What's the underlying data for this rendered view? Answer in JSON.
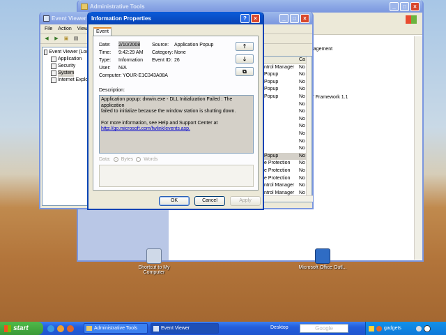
{
  "admin_window": {
    "title": "Administrative Tools",
    "right_items": [
      "anagement",
      "ET Framework 1.1"
    ]
  },
  "event_viewer": {
    "title": "Event Viewer",
    "menu": [
      "File",
      "Action",
      "View"
    ],
    "tree": [
      "Event Viewer (Loc",
      "Application",
      "Security",
      "System",
      "Internet Explo"
    ],
    "col_source_header": "",
    "col_category_header": "Ca",
    "rows": [
      {
        "source": "ntrol Manager",
        "cat": "No"
      },
      {
        "source": "Popup",
        "cat": "No"
      },
      {
        "source": "Popup",
        "cat": "No"
      },
      {
        "source": "Popup",
        "cat": "No"
      },
      {
        "source": "Popup",
        "cat": "No"
      },
      {
        "source": "",
        "cat": "No"
      },
      {
        "source": "",
        "cat": "No"
      },
      {
        "source": "",
        "cat": "No"
      },
      {
        "source": "",
        "cat": "No"
      },
      {
        "source": "",
        "cat": "No"
      },
      {
        "source": "",
        "cat": "No"
      },
      {
        "source": "",
        "cat": "No"
      },
      {
        "source": "Popup",
        "cat": "No"
      },
      {
        "source": "e Protection",
        "cat": "No"
      },
      {
        "source": "e Protection",
        "cat": "No"
      },
      {
        "source": "e Protection",
        "cat": "No"
      },
      {
        "source": "ntrol Manager",
        "cat": "No"
      },
      {
        "source": "ntrol Manager",
        "cat": "No"
      }
    ]
  },
  "dialog": {
    "title": "Information Properties",
    "help": "?",
    "tab": "Event",
    "fields": {
      "date_label": "Date:",
      "date": "2/10/2008",
      "time_label": "Time:",
      "time": "9:42:29 AM",
      "type_label": "Type:",
      "type": "Information",
      "user_label": "User:",
      "user": "N/A",
      "computer_label": "Computer:",
      "computer": "YOUR-E1C343A08A",
      "source_label": "Source:",
      "source": "Application Popup",
      "category_label": "Category:",
      "category": "None",
      "event_id_label": "Event ID:",
      "event_id": "26"
    },
    "description_label": "Description:",
    "description_line1": "Application popup: dwwin.exe - DLL Initialization Failed : The application",
    "description_line2": "failed to initialize because the window station is shutting down.",
    "description_line3": "For more information, see Help and Support Center at",
    "description_link": "http://go.microsoft.com/fwlink/events.asp.",
    "data_label": "Data:",
    "bytes_label": "Bytes",
    "words_label": "Words",
    "ok": "OK",
    "cancel": "Cancel",
    "apply": "Apply",
    "up_arrow": "🡑",
    "down_arrow": "🡓",
    "copy_icon": "⧉"
  },
  "desktop_icons": [
    {
      "label": "Shortcut to My Computer"
    },
    {
      "label": "Microsoft Office Outl..."
    }
  ],
  "taskbar": {
    "start": "start",
    "tasks": [
      "Administrative Tools",
      "Event Viewer"
    ],
    "desktop_label": "Desktop",
    "search_placeholder": "Google",
    "gadgets": "gadgets"
  }
}
